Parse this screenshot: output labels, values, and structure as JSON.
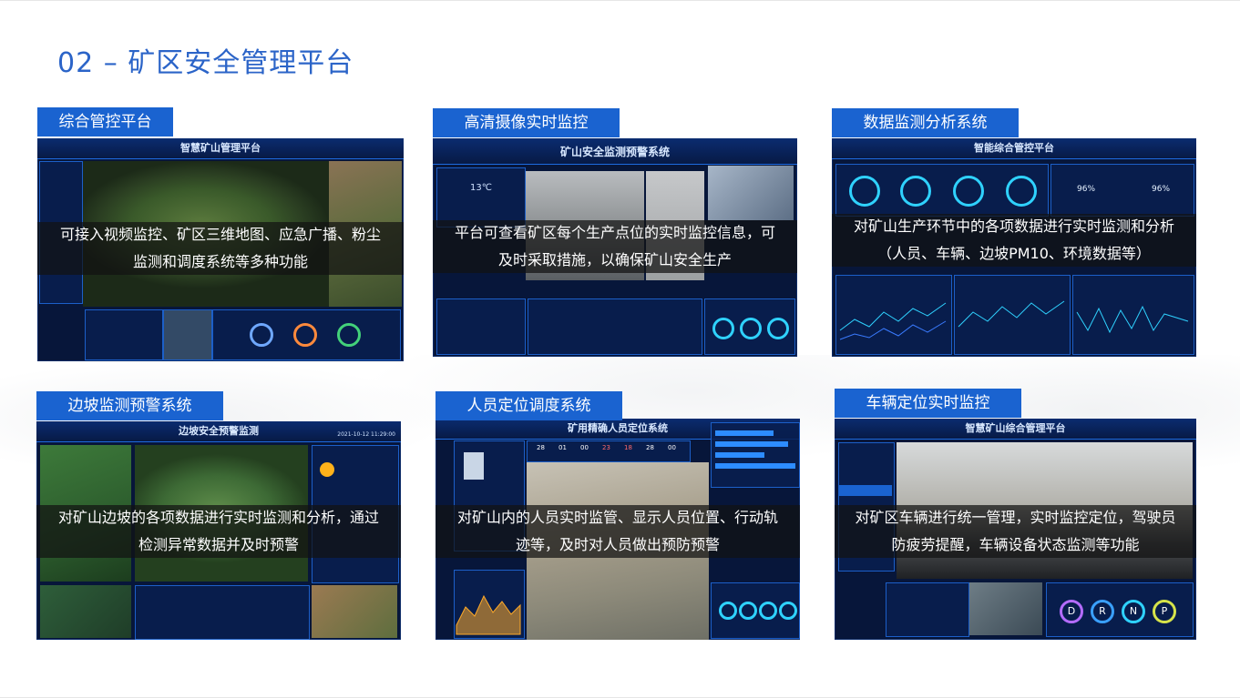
{
  "page": {
    "title": "02 – 矿区安全管理平台"
  },
  "cards": [
    {
      "label": "综合管控平台",
      "screen_title": "智慧矿山管理平台",
      "description_line1": "可接入视频监控、矿区三维地图、应急广播、粉尘",
      "description_line2": "监测和调度系统等多种功能"
    },
    {
      "label": "高清摄像实时监控",
      "screen_title": "矿山安全监测预警系统",
      "temperature": "13℃",
      "description_line1": "平台可查看矿区每个生产点位的实时监控信息，可",
      "description_line2": "及时采取措施，以确保矿山安全生产"
    },
    {
      "label": "数据监测分析系统",
      "screen_title": "智能综合管控平台",
      "gauge_a": "96%",
      "gauge_b": "96%",
      "description_line1": "对矿山生产环节中的各项数据进行实时监测和分析",
      "description_line2": "（人员、车辆、边坡PM10、环境数据等）"
    },
    {
      "label": "边坡监测预警系统",
      "screen_title": "边坡安全预警监测",
      "timestamp": "2021-10-12 11:29:00",
      "description_line1": "对矿山边坡的各项数据进行实时监测和分析，通过",
      "description_line2": "检测异常数据并及时预警"
    },
    {
      "label": "人员定位调度系统",
      "screen_title": "矿用精确人员定位系统",
      "counts": [
        "28",
        "01",
        "00",
        "23",
        "18",
        "28",
        "00"
      ],
      "description_line1": "对矿山内的人员实时监管、显示人员位置、行动轨",
      "description_line2": "迹等，及时对人员做出预防预警"
    },
    {
      "label": "车辆定位实时监控",
      "screen_title": "智慧矿山综合管理平台",
      "gear_buttons": [
        "D",
        "R",
        "N",
        "P"
      ],
      "description_line1": "对矿区车辆进行统一管理，实时监控定位，驾驶员",
      "description_line2": "防疲劳提醒，车辆设备状态监测等功能"
    }
  ],
  "colors": {
    "title": "#2b64c8",
    "label_bg": "#1a63d0",
    "screen_bg": "#07163a",
    "accent_cyan": "#2fd2ff"
  }
}
